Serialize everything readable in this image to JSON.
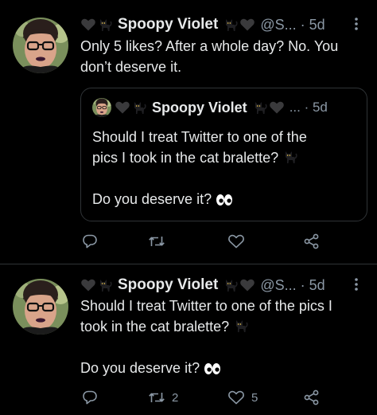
{
  "tweets": [
    {
      "author_name": "Spoopy Violet",
      "handle": "@S...",
      "separator": "·",
      "time": "5d",
      "lines": [
        "Only 5 likes? After a whole day? No. You",
        "don’t deserve it."
      ],
      "quote": {
        "author_name": "Spoopy Violet",
        "meta": "... · 5d",
        "text_line1": "Should I treat Twitter to one of the",
        "text_line2": "pics I took in the cat bralette?",
        "text_line3": "Do you deserve it?"
      },
      "actions": {
        "reply_count": "",
        "retweet_count": "",
        "like_count": ""
      }
    },
    {
      "author_name": "Spoopy Violet",
      "handle": "@S...",
      "separator": "·",
      "time": "5d",
      "line1": "Should I treat Twitter to one of the pics I",
      "line2": "took in the cat bralette?",
      "line3": "Do you deserve it?",
      "actions": {
        "reply_count": "",
        "retweet_count": "2",
        "like_count": "5"
      }
    }
  ],
  "icons": {
    "more": "more-vertical-icon",
    "reply": "reply-bubble-icon",
    "retweet": "retweet-icon",
    "like": "heart-outline-icon",
    "share": "share-icon",
    "name_emoji_left": [
      "black-heart-emoji",
      "black-cat-emoji"
    ],
    "name_emoji_right": [
      "black-cat-emoji",
      "black-heart-emoji"
    ],
    "eyes": "eyes-emoji"
  },
  "colors": {
    "background": "#000000",
    "text": "#e7e9ea",
    "secondary": "#8b98a5",
    "divider": "#2f3336"
  }
}
